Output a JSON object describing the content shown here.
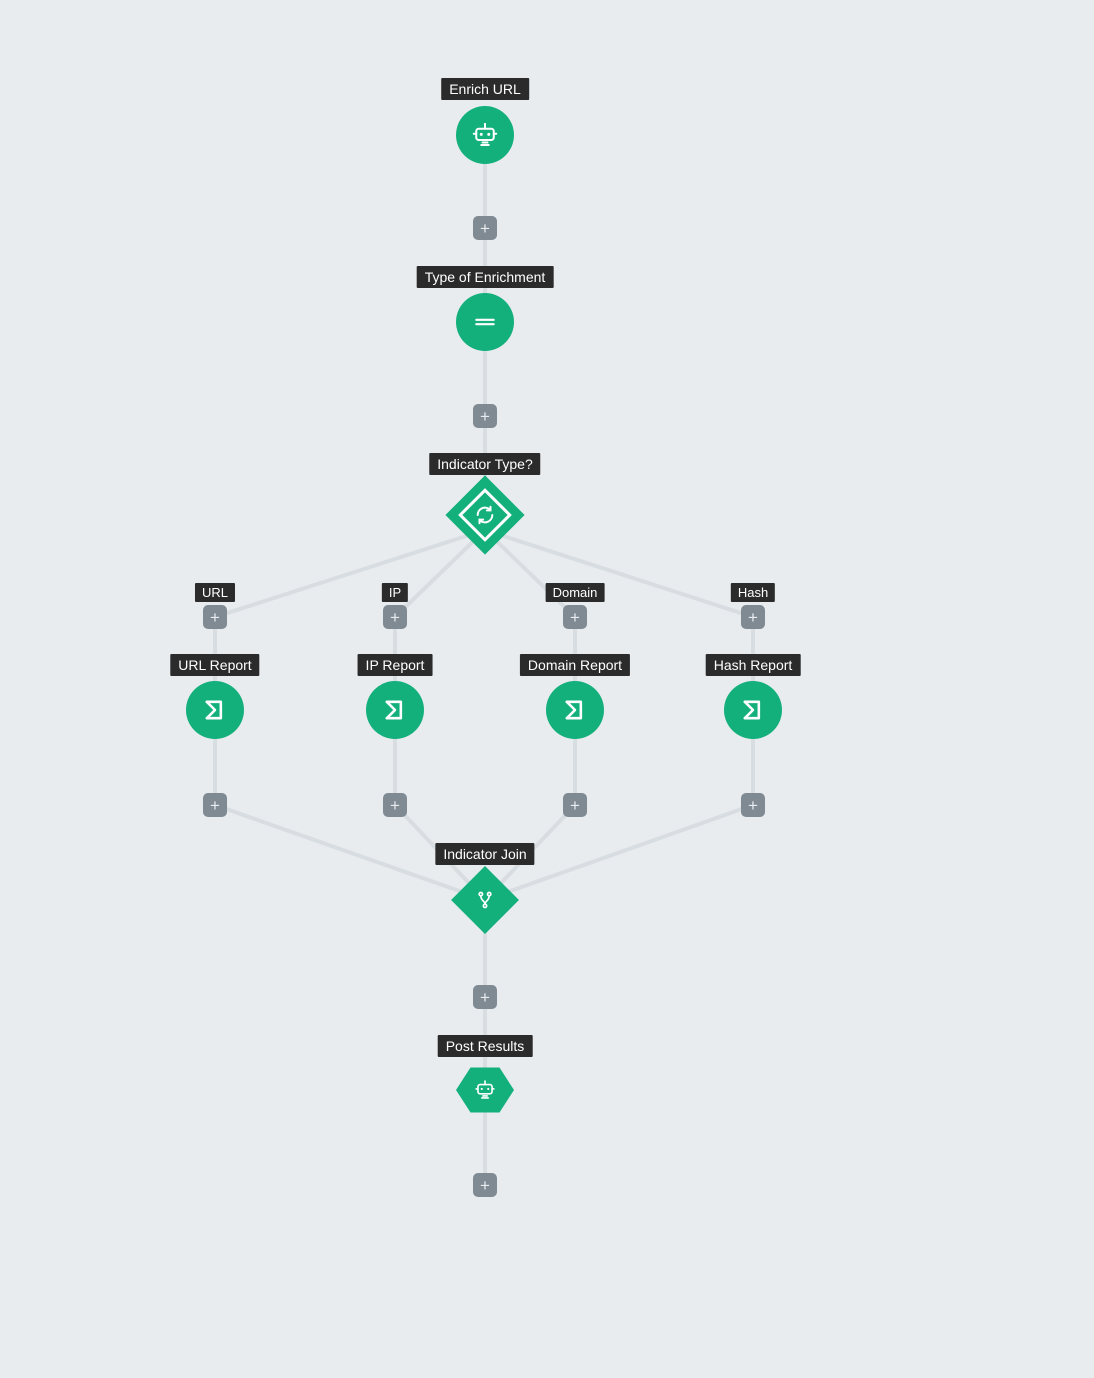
{
  "colors": {
    "accent": "#14b07c",
    "plus_button": "#7f8a93",
    "label_bg": "#2b2b2b",
    "canvas_bg": "#e8ecef",
    "edge": "#d8dde1"
  },
  "nodes": {
    "enrich_url": {
      "label": "Enrich URL",
      "icon": "robot",
      "shape": "circle"
    },
    "type_of_enrichment": {
      "label": "Type of Enrichment",
      "icon": "menu",
      "shape": "circle"
    },
    "indicator_type": {
      "label": "Indicator Type?",
      "icon": "refresh",
      "shape": "diamond-branch"
    },
    "url_report": {
      "label": "URL Report",
      "icon": "sigma",
      "shape": "circle"
    },
    "ip_report": {
      "label": "IP Report",
      "icon": "sigma",
      "shape": "circle"
    },
    "domain_report": {
      "label": "Domain Report",
      "icon": "sigma",
      "shape": "circle"
    },
    "hash_report": {
      "label": "Hash Report",
      "icon": "sigma",
      "shape": "circle"
    },
    "indicator_join": {
      "label": "Indicator Join",
      "icon": "merge",
      "shape": "diamond"
    },
    "post_results": {
      "label": "Post Results",
      "icon": "robot",
      "shape": "hex"
    }
  },
  "branches": {
    "url": {
      "label": "URL"
    },
    "ip": {
      "label": "IP"
    },
    "domain": {
      "label": "Domain"
    },
    "hash": {
      "label": "Hash"
    }
  },
  "plus_button_glyph": "+"
}
